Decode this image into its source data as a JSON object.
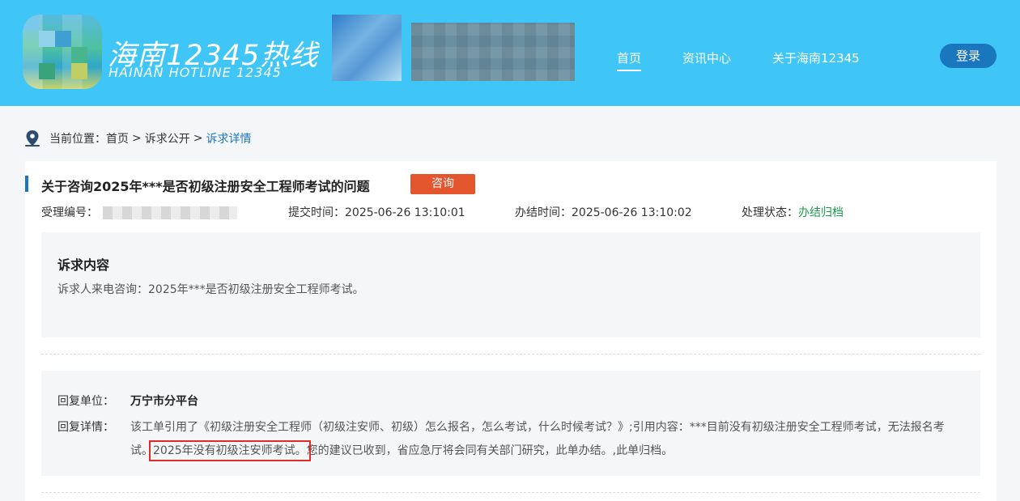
{
  "header": {
    "brand_cn": "海南12345热线",
    "brand_en": "HAINAN HOTLINE 12345",
    "nav": [
      {
        "label": "首页",
        "active": true
      },
      {
        "label": "资讯中心",
        "active": false
      },
      {
        "label": "关于海南12345",
        "active": false
      }
    ],
    "login_label": "登录"
  },
  "breadcrumb": {
    "prefix": "当前位置：",
    "items": [
      "首页",
      "诉求公开"
    ],
    "separator": ">",
    "current": "诉求详情"
  },
  "detail": {
    "title": "关于咨询2025年***是否初级注册安全工程师考试的问题",
    "tag": "咨询",
    "case_no_label": "受理编号：",
    "submit_time_label": "提交时间：",
    "submit_time": "2025-06-26 13:10:01",
    "close_time_label": "办结时间：",
    "close_time": "2025-06-26 13:10:02",
    "status_label": "处理状态：",
    "status": "办结归档"
  },
  "request": {
    "heading": "诉求内容",
    "text": "诉求人来电咨询：2025年***是否初级注册安全工程师考试。"
  },
  "reply": {
    "unit_label": "回复单位：",
    "unit": "万宁市分平台",
    "detail_label": "回复详情：",
    "detail_before": "该工单引用了《初级注册安全工程师（初级注安师、初级）怎么报名，怎么考试，什么时候考试？》;引用内容：***目前没有初级注册安全工程师考试，无法报名考试。",
    "detail_highlight": "2025年没有初级注安师考试。",
    "detail_after": "您的建议已收到，省应急厅将会同有关部门研究，此单办结。,此单归档。"
  },
  "colors": {
    "header_bg": "#3fc5f6",
    "accent": "#1a76bd",
    "tag_bg": "#e2552d",
    "status_green": "#1a9b4f",
    "highlight_border": "#e02b2b"
  }
}
